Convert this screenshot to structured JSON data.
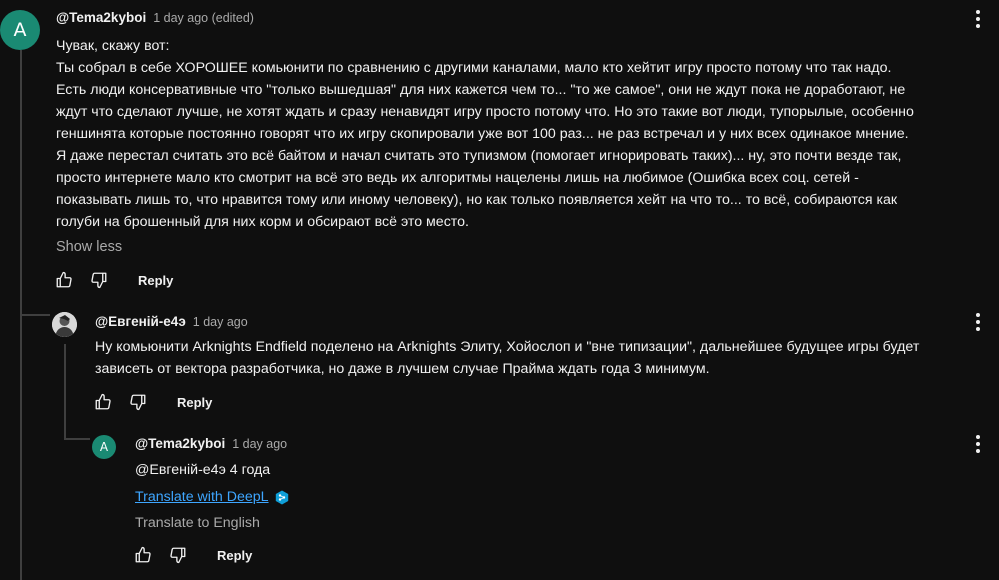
{
  "comment": {
    "avatar_letter": "A",
    "author": "@Tema2kyboi",
    "date": "1 day ago (edited)",
    "lines": [
      "Чувак, скажу вот:",
      "Ты собрал в себе ХОРОШЕЕ комьюнити по сравнению с другими каналами, мало кто хейтит игру просто потому что так надо.",
      "Есть люди консервативные что \"только вышедшая\" для них кажется чем то... \"то же самое\", они не ждут пока не доработают, не",
      "ждут что сделают лучше, не хотят ждать и сразу ненавидят игру просто потому что. Но это такие вот люди, тупорылые, особенно",
      "геншинята которые постоянно говорят что их игру скопировали уже вот 100 раз... не раз встречал и у них всех одинакое мнение.",
      "Я даже перестал считать это всё байтом и начал считать это тупизмом (помогает игнорировать таких)... ну, это почти везде так,",
      "просто интернете мало кто смотрит на всё это ведь их алгоритмы нацелены лишь на любимое (Ошибка всех соц. сетей -",
      "показывать лишь то, что нравится тому или иному человеку), но как только появляется хейт на что то... то всё, собираются как",
      "голуби на брошенный для них корм и обсирают всё это место."
    ],
    "show_less": "Show less",
    "reply_label": "Reply"
  },
  "reply1": {
    "author": "@Евгеній-е4э",
    "date": "1 day ago",
    "lines": [
      "Ну комьюнити Arknights Endfield поделено на Arknights Элиту, Хойослоп и \"вне типизации\", дальнейшее будущее игры будет",
      "зависеть от вектора разработчика, но даже в лучшем случае Прайма ждать года 3 минимум."
    ],
    "reply_label": "Reply"
  },
  "reply2": {
    "avatar_letter": "A",
    "author": "@Tema2kyboi",
    "date": "1 day ago",
    "text": "@Евгеній-е4э 4 года",
    "translate_deepl": "Translate with DeepL",
    "translate_english": "Translate to English",
    "reply_label": "Reply"
  },
  "colors": {
    "background": "#0f0f0f",
    "text": "#f1f1f1",
    "secondary": "#aaaaaa",
    "link": "#3ea6ff",
    "avatar": "#1a8a73",
    "deepl_icon": "#0f9fd8"
  },
  "icons": {
    "like": "thumb-up-icon",
    "dislike": "thumb-down-icon",
    "menu": "three-dots-vertical-icon",
    "deepl": "deepl-icon"
  }
}
